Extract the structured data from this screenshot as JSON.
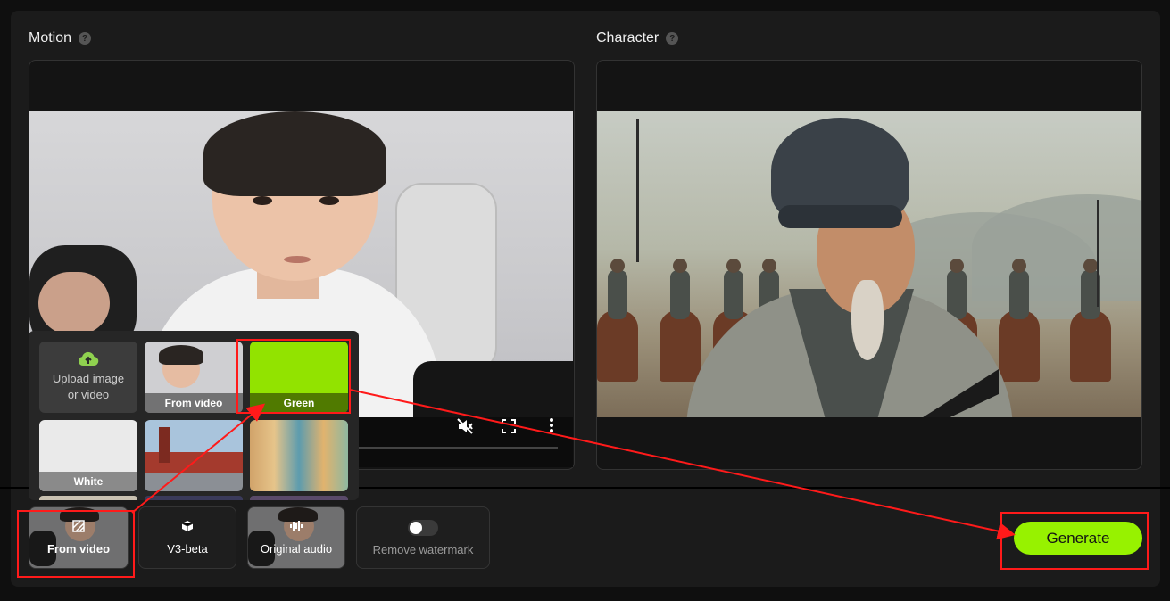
{
  "motion": {
    "title": "Motion",
    "help_icon": "?"
  },
  "character": {
    "title": "Character",
    "help_icon": "?"
  },
  "video_controls": {
    "mute_icon": "volume-mute-icon",
    "fullscreen_icon": "fullscreen-icon",
    "more_icon": "more-vertical-icon"
  },
  "background_picker": {
    "upload": {
      "line1": "Upload image",
      "line2": "or video",
      "icon": "cloud-upload-icon"
    },
    "tiles": [
      {
        "label": "From video"
      },
      {
        "label": "Green",
        "color": "#92e300"
      },
      {
        "label": "White",
        "color": "#eaeaea"
      },
      {
        "label": ""
      },
      {
        "label": ""
      }
    ]
  },
  "toolbar": {
    "background_label": "From video",
    "model_label": "V3-beta",
    "audio_label": "Original audio",
    "watermark_label": "Remove watermark",
    "watermark_enabled": false
  },
  "generate": {
    "label": "Generate",
    "color": "#97f200"
  },
  "annotation_color": "#ff1a1a"
}
